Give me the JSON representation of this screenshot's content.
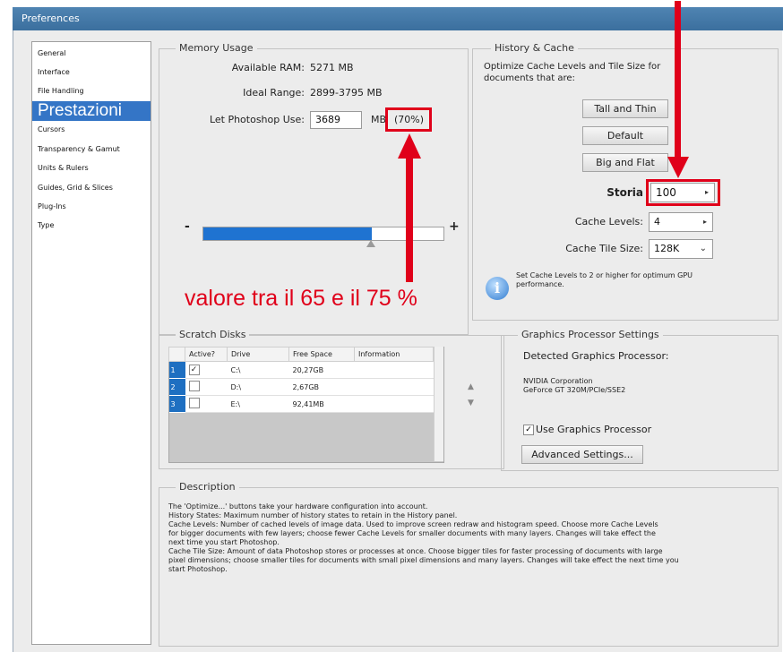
{
  "window": {
    "title": "Preferences"
  },
  "sidebar": {
    "items": [
      {
        "label": "General"
      },
      {
        "label": "Interface"
      },
      {
        "label": "File Handling"
      },
      {
        "label": "Prestazioni"
      },
      {
        "label": "Cursors"
      },
      {
        "label": "Transparency & Gamut"
      },
      {
        "label": "Units & Rulers"
      },
      {
        "label": "Guides, Grid & Slices"
      },
      {
        "label": "Plug-Ins"
      },
      {
        "label": "Type"
      }
    ],
    "selected_index": 3
  },
  "memory": {
    "title": "Memory Usage",
    "available_label": "Available RAM:",
    "available_value": "5271 MB",
    "ideal_label": "Ideal Range:",
    "ideal_value": "2899-3795 MB",
    "let_label": "Let Photoshop Use:",
    "let_value": "3689",
    "unit": "MB",
    "percent": "(70%)",
    "slider_fraction": 0.7,
    "minus": "-",
    "plus": "+"
  },
  "annotation": {
    "text": "valore tra il 65 e il 75 %",
    "color": "#e0001a"
  },
  "history": {
    "title": "History & Cache",
    "optimize_text_1": "Optimize Cache Levels and Tile Size for",
    "optimize_text_2": "documents that are:",
    "btn_tall": "Tall and Thin",
    "btn_default": "Default",
    "btn_big": "Big and Flat",
    "storia_label": "Storia",
    "storia_value": "100",
    "cache_levels_label": "Cache Levels:",
    "cache_levels_value": "4",
    "tile_size_label": "Cache Tile Size:",
    "tile_size_value": "128K",
    "info_text_1": "Set Cache Levels to 2 or higher for optimum GPU",
    "info_text_2": "performance.",
    "info_icon": "i"
  },
  "scratch": {
    "title": "Scratch Disks",
    "columns": [
      "Active?",
      "Drive",
      "Free Space",
      "Information"
    ],
    "rows": [
      {
        "num": "1",
        "active": "✓",
        "drive": "C:\\",
        "free": "20,27GB",
        "info": ""
      },
      {
        "num": "2",
        "active": "",
        "drive": "D:\\",
        "free": "2,67GB",
        "info": ""
      },
      {
        "num": "3",
        "active": "",
        "drive": "E:\\",
        "free": "92,41MB",
        "info": ""
      }
    ]
  },
  "gpu": {
    "title": "Graphics Processor Settings",
    "detected_label": "Detected Graphics Processor:",
    "vendor": "NVIDIA Corporation",
    "model": "GeForce GT 320M/PCIe/SSE2",
    "use_check": "✓",
    "use_label": "Use Graphics Processor",
    "advanced": "Advanced Settings..."
  },
  "description": {
    "title": "Description",
    "lines": [
      "The 'Optimize...' buttons take your hardware configuration into account.",
      "History States: Maximum number of history states to retain in the History panel.",
      "Cache Levels: Number of cached levels of image data.  Used to improve screen redraw and histogram speed.  Choose more Cache Levels",
      "for bigger documents with few layers; choose fewer Cache Levels for smaller documents with many layers. Changes will take effect the",
      "next time you start Photoshop.",
      "Cache Tile Size: Amount of data Photoshop stores or processes at once. Choose bigger tiles for faster processing of documents with large",
      "pixel dimensions; choose smaller tiles for documents with small pixel dimensions and many layers. Changes will take effect the next time you",
      "start Photoshop."
    ]
  }
}
